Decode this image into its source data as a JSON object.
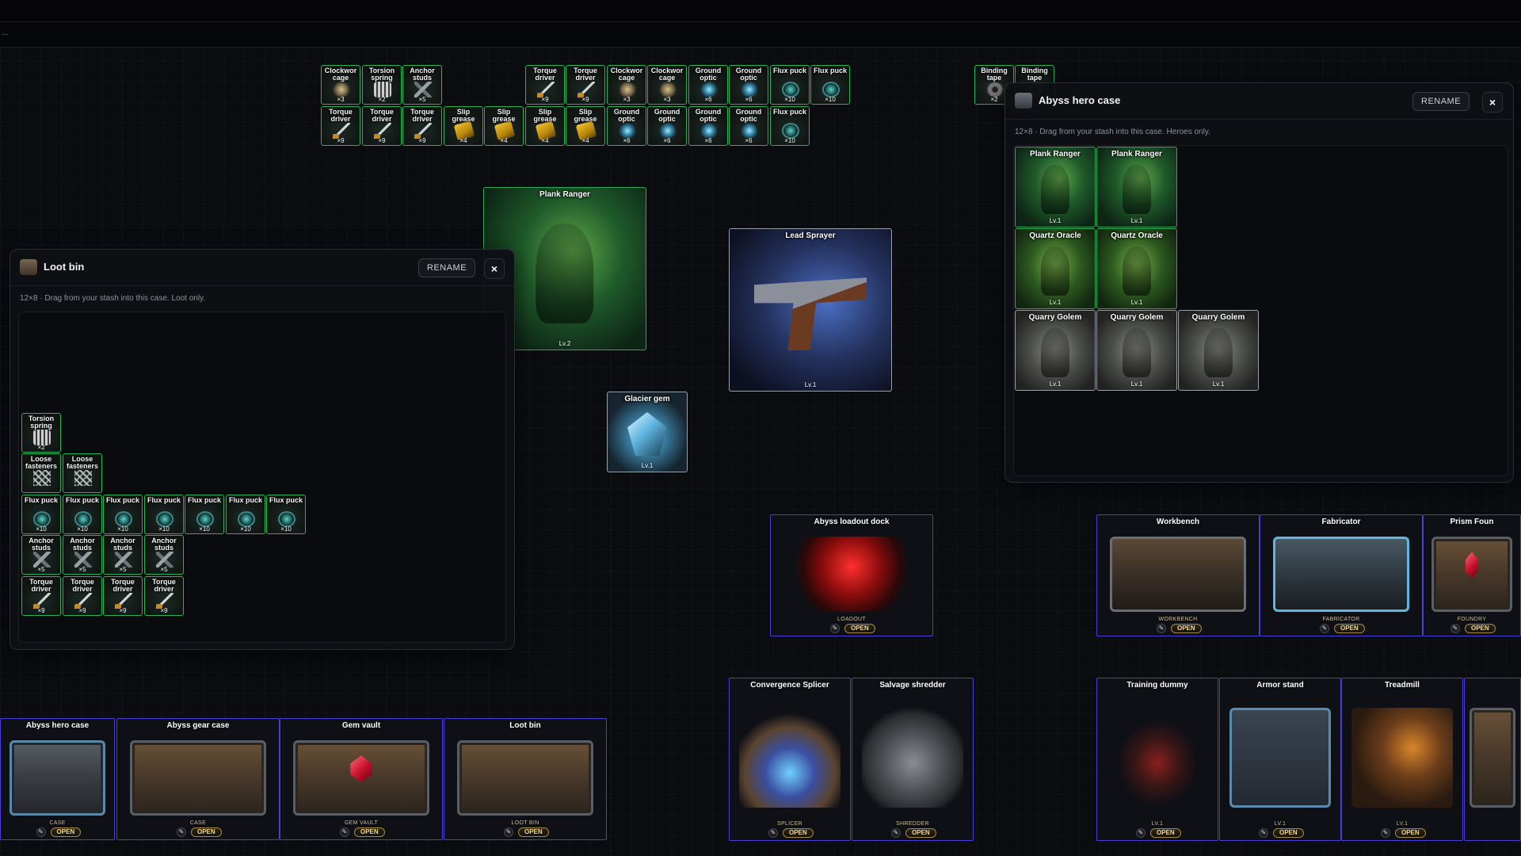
{
  "toolbar": {
    "dots": "..."
  },
  "stash_items": [
    {
      "name": "Clockwor cage",
      "qty": "×3",
      "art": "cage"
    },
    {
      "name": "Torsion spring",
      "qty": "×2",
      "art": "spring"
    },
    {
      "name": "Anchor studs",
      "qty": "×5",
      "art": "studs"
    },
    {
      "name": "Torque driver",
      "qty": "×9",
      "art": "driver"
    },
    {
      "name": "Torque driver",
      "qty": "×9",
      "art": "driver"
    },
    {
      "name": "Clockwor cage",
      "qty": "×3",
      "art": "cage"
    },
    {
      "name": "Clockwor cage",
      "qty": "×3",
      "art": "cage"
    },
    {
      "name": "Ground optic",
      "qty": "×6",
      "art": "optic"
    },
    {
      "name": "Ground optic",
      "qty": "×6",
      "art": "optic"
    },
    {
      "name": "Flux puck",
      "qty": "×10",
      "art": "puck"
    },
    {
      "name": "Flux puck",
      "qty": "×10",
      "art": "puck"
    },
    {
      "name": "Binding tape",
      "qty": "×2",
      "art": "tape"
    },
    {
      "name": "Binding tape",
      "qty": "",
      "art": "tape"
    },
    {
      "name": "Torque driver",
      "qty": "×9",
      "art": "driver"
    },
    {
      "name": "Torque driver",
      "qty": "×9",
      "art": "driver"
    },
    {
      "name": "Torque driver",
      "qty": "×9",
      "art": "driver"
    },
    {
      "name": "Slip grease",
      "qty": "×4",
      "art": "grease"
    },
    {
      "name": "Slip grease",
      "qty": "×4",
      "art": "grease"
    },
    {
      "name": "Slip grease",
      "qty": "×4",
      "art": "grease"
    },
    {
      "name": "Slip grease",
      "qty": "×4",
      "art": "grease"
    },
    {
      "name": "Ground optic",
      "qty": "×6",
      "art": "optic"
    },
    {
      "name": "Ground optic",
      "qty": "×6",
      "art": "optic"
    },
    {
      "name": "Ground optic",
      "qty": "×6",
      "art": "optic"
    },
    {
      "name": "Ground optic",
      "qty": "×6",
      "art": "optic"
    },
    {
      "name": "Flux puck",
      "qty": "×10",
      "art": "puck"
    }
  ],
  "cards": {
    "ranger": {
      "title": "Plank Ranger",
      "level": "Lv.2"
    },
    "sprayer": {
      "title": "Lead Sprayer",
      "level": "Lv.1"
    },
    "gem": {
      "title": "Glacier gem",
      "level": "Lv.1"
    }
  },
  "loot_panel": {
    "title": "Loot bin",
    "rename": "RENAME",
    "close": "×",
    "hint": "12×8 · Drag from your stash into this case. Loot only.",
    "items": [
      {
        "name": "Torsion spring",
        "qty": "×2",
        "art": "spring"
      },
      {
        "name": "Loose fasteners",
        "qty": "",
        "art": "fasten"
      },
      {
        "name": "Loose fasteners",
        "qty": "",
        "art": "fasten"
      },
      {
        "name": "Flux puck",
        "qty": "×10",
        "art": "puck"
      },
      {
        "name": "Flux puck",
        "qty": "×10",
        "art": "puck"
      },
      {
        "name": "Flux puck",
        "qty": "×10",
        "art": "puck"
      },
      {
        "name": "Flux puck",
        "qty": "×10",
        "art": "puck"
      },
      {
        "name": "Flux puck",
        "qty": "×10",
        "art": "puck"
      },
      {
        "name": "Flux puck",
        "qty": "×10",
        "art": "puck"
      },
      {
        "name": "Flux puck",
        "qty": "×10",
        "art": "puck"
      },
      {
        "name": "Anchor studs",
        "qty": "×5",
        "art": "studs"
      },
      {
        "name": "Anchor studs",
        "qty": "×5",
        "art": "studs"
      },
      {
        "name": "Anchor studs",
        "qty": "×5",
        "art": "studs"
      },
      {
        "name": "Anchor studs",
        "qty": "×5",
        "art": "studs"
      },
      {
        "name": "Torque driver",
        "qty": "×9",
        "art": "driver"
      },
      {
        "name": "Torque driver",
        "qty": "×9",
        "art": "driver"
      },
      {
        "name": "Torque driver",
        "qty": "×9",
        "art": "driver"
      },
      {
        "name": "Torque driver",
        "qty": "×9",
        "art": "driver"
      }
    ]
  },
  "hero_panel": {
    "title": "Abyss hero case",
    "rename": "RENAME",
    "close": "×",
    "hint": "12×8 · Drag from your stash into this case. Heroes only.",
    "heroes": [
      {
        "name": "Plank Ranger",
        "level": "Lv.1",
        "kind": "ranger"
      },
      {
        "name": "Plank Ranger",
        "level": "Lv.1",
        "kind": "ranger"
      },
      {
        "name": "Quartz Oracle",
        "level": "Lv.1",
        "kind": "oracle"
      },
      {
        "name": "Quartz Oracle",
        "level": "Lv.1",
        "kind": "oracle"
      },
      {
        "name": "Quarry Golem",
        "level": "Lv.1",
        "kind": "golem"
      },
      {
        "name": "Quarry Golem",
        "level": "Lv.1",
        "kind": "golem"
      },
      {
        "name": "Quarry Golem",
        "level": "Lv.1",
        "kind": "golem"
      }
    ]
  },
  "stations": {
    "open_label": "OPEN",
    "pen_glyph": "✎",
    "list": [
      {
        "title": "Abyss loadout dock",
        "sub": "LOADOUT",
        "art": "portal"
      },
      {
        "title": "Workbench",
        "sub": "WORKBENCH",
        "art": "bench"
      },
      {
        "title": "Fabricator",
        "sub": "FABRICATOR",
        "art": "bench-blue"
      },
      {
        "title": "Prism Foun",
        "sub": "FOUNDRY",
        "art": "chest-gem"
      },
      {
        "title": "Convergence Splicer",
        "sub": "SPLICER",
        "art": "splicer"
      },
      {
        "title": "Salvage shredder",
        "sub": "SHREDDER",
        "art": "shredder"
      },
      {
        "title": "Training dummy",
        "sub": "LV.1",
        "art": "dummy"
      },
      {
        "title": "Armor stand",
        "sub": "LV.1",
        "art": "armor"
      },
      {
        "title": "Treadmill",
        "sub": "LV.1",
        "art": "tread"
      },
      {
        "title": "",
        "sub": "",
        "art": "chest"
      },
      {
        "title": "Abyss hero case",
        "sub": "CASE",
        "art": "chest-blue"
      },
      {
        "title": "Abyss gear case",
        "sub": "CASE",
        "art": "chest"
      },
      {
        "title": "Gem vault",
        "sub": "GEM VAULT",
        "art": "chest-gem"
      },
      {
        "title": "Loot bin",
        "sub": "LOOT BIN",
        "art": "chest"
      }
    ]
  }
}
